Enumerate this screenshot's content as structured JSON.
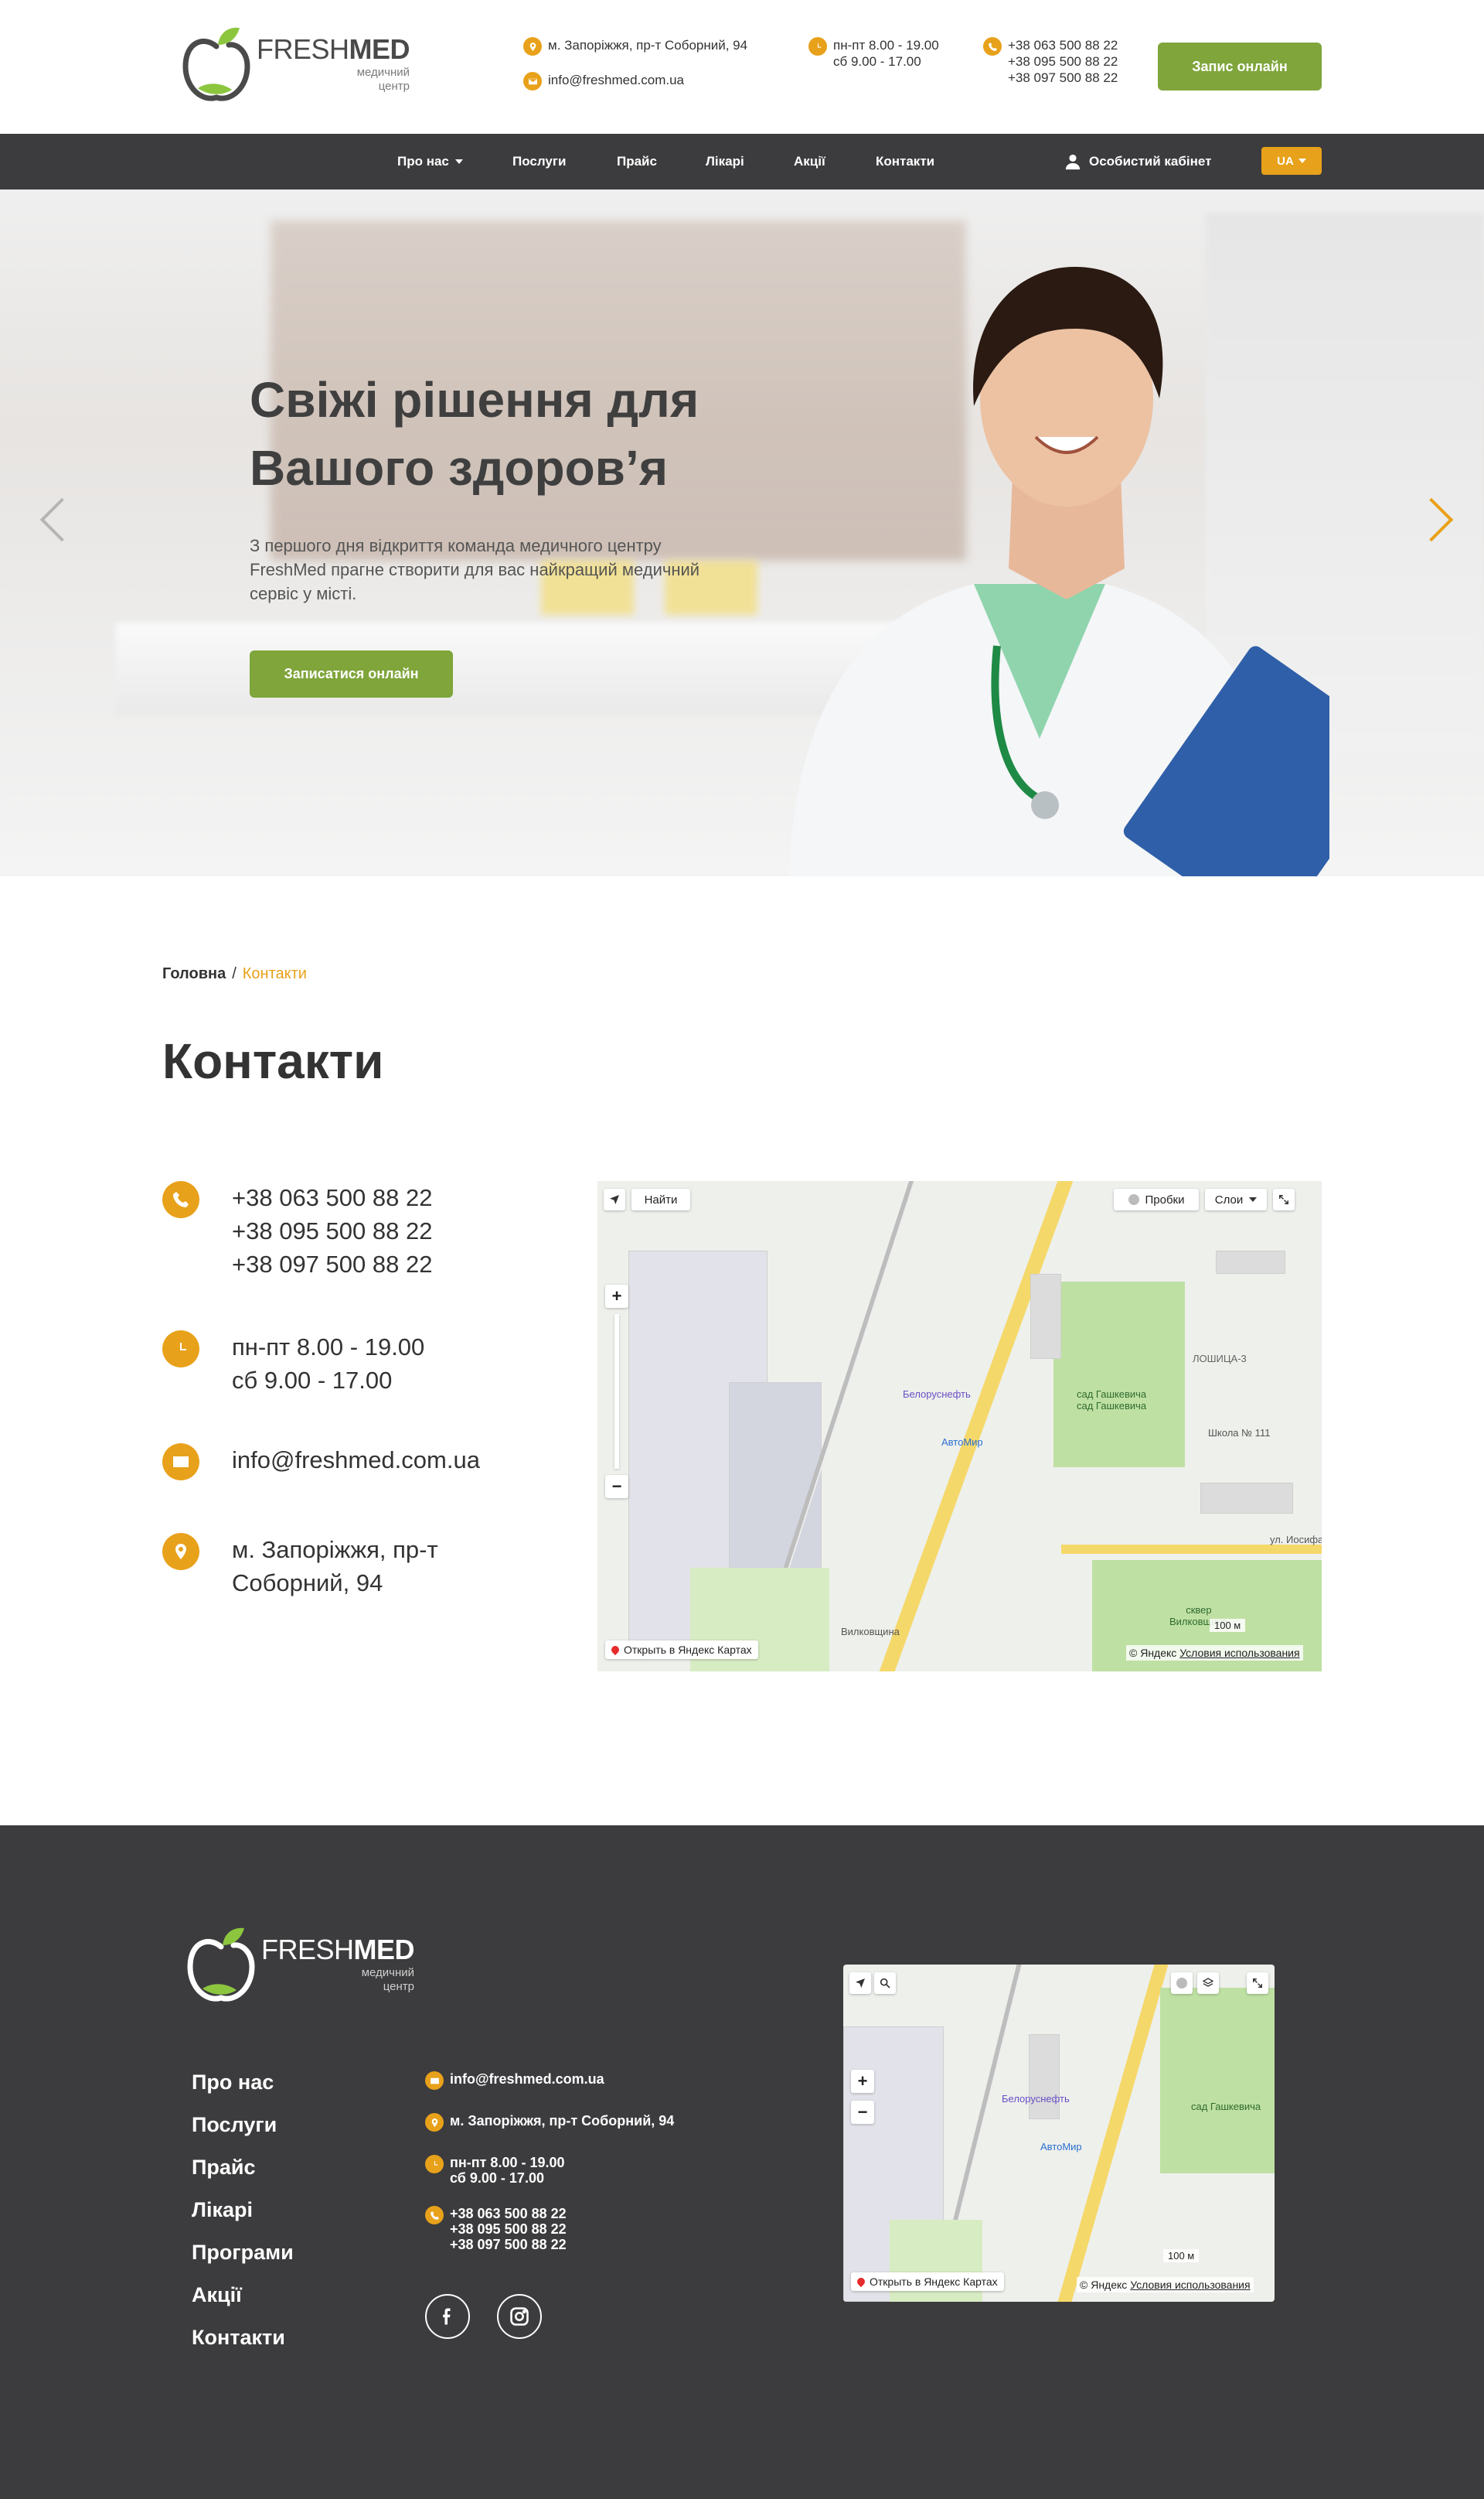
{
  "brand": {
    "name_light": "FRESH",
    "name_bold": "MED",
    "subtitle_line1": "медичний",
    "subtitle_line2": "центр"
  },
  "header": {
    "address": "м. Запоріжжя, пр-т Соборний, 94",
    "email": "info@freshmed.com.ua",
    "hours": [
      "пн-пт 8.00 - 19.00",
      "сб 9.00 - 17.00"
    ],
    "phones": [
      "+38 063 500 88 22",
      "+38 095 500 88 22",
      "+38 097 500 88 22"
    ],
    "cta_label": "Запис онлайн"
  },
  "nav": {
    "items": [
      "Про нас",
      "Послуги",
      "Прайс",
      "Лікарі",
      "Акції",
      "Контакти"
    ],
    "cabinet_label": "Особистий кабінет",
    "language": "UA"
  },
  "hero": {
    "title": "Свіжі рішення для Вашого здоров’я",
    "description": "З першого дня відкриття команда медичного центру FreshMed прагне створити для вас найкращий медичний сервіс у місті.",
    "cta_label": "Записатися онлайн",
    "slide_count": 4,
    "active_slide": 1
  },
  "breadcrumb": {
    "home": "Головна",
    "separator": "/",
    "current": "Контакти"
  },
  "page_title": "Контакти",
  "contacts": {
    "phones": [
      "+38 063 500 88 22",
      "+38 095 500 88 22",
      "+38 097 500 88 22"
    ],
    "hours": [
      "пн-пт 8.00 - 19.00",
      "сб 9.00 - 17.00"
    ],
    "email": "info@freshmed.com.ua",
    "address": [
      "м. Запоріжжя, пр-т",
      "Соборний, 94"
    ]
  },
  "map_main": {
    "find_label": "Найти",
    "traffic_label": "Пробки",
    "layers_label": "Слои",
    "zoom_in": "+",
    "zoom_out": "−",
    "open_label": "Открыть в Яндекс Картах",
    "copyright": "© Яндекс",
    "terms": "Условия использования",
    "scale": "100 м",
    "labels": {
      "district": "ЛОШИЦА-3",
      "park1_line1": "сад Гашкевича",
      "park1_line2": "сад Гашкевича",
      "park2_line1": "сквер",
      "park2_line2": "Вилковщина",
      "school": "Школа № 111",
      "shop1": "Белоруснефть",
      "shop2": "АвтоМир",
      "street": "ул. Иосифа",
      "area": "Вилковщина"
    }
  },
  "map_footer": {
    "zoom_in": "+",
    "zoom_out": "−",
    "open_label": "Открыть в Яндекс Картах",
    "copyright": "© Яндекс",
    "terms": "Условия использования",
    "scale": "100 м",
    "labels": {
      "park": "сад Гашкевича",
      "shop1": "Белоруснефть",
      "shop2": "АвтоМир"
    }
  },
  "footer": {
    "menu": [
      "Про нас",
      "Послуги",
      "Прайс",
      "Лікарі",
      "Програми",
      "Акції",
      "Контакти"
    ],
    "email": "info@freshmed.com.ua",
    "address": "м. Запоріжжя, пр-т Соборний, 94",
    "hours": [
      "пн-пт 8.00 - 19.00",
      "сб 9.00 - 17.00"
    ],
    "phones": [
      "+38 063 500 88 22",
      "+38 095 500 88 22",
      "+38 097 500 88 22"
    ],
    "social": [
      "facebook-icon",
      "instagram-icon"
    ]
  },
  "colors": {
    "accent": "#e8a11a",
    "brand_green": "#7fa53b",
    "dark": "#3c3c3e"
  }
}
